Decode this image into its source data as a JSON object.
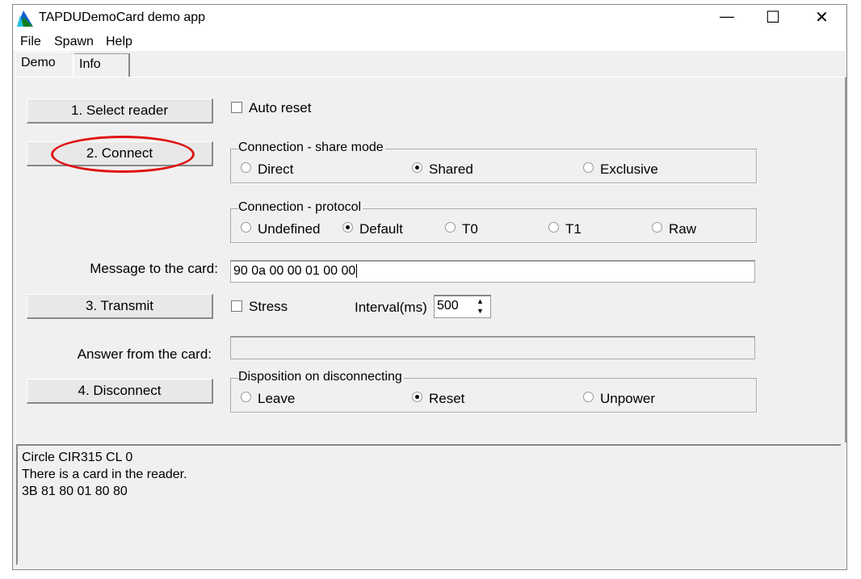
{
  "window": {
    "title": "TAPDUDemoCard demo app",
    "minimize": "—",
    "maximize": "☐",
    "close": "✕"
  },
  "menu": [
    "File",
    "Spawn",
    "Help"
  ],
  "tabs": [
    "Demo",
    "Info"
  ],
  "buttons": {
    "select_reader": "1. Select reader",
    "connect": "2. Connect",
    "transmit": "3. Transmit",
    "disconnect": "4. Disconnect"
  },
  "auto_reset": "Auto reset",
  "share_mode": {
    "legend": "Connection - share mode",
    "options": [
      "Direct",
      "Shared",
      "Exclusive"
    ],
    "selected": "Shared"
  },
  "protocol": {
    "legend": "Connection - protocol",
    "options": [
      "Undefined",
      "Default",
      "T0",
      "T1",
      "Raw"
    ],
    "selected": "Default"
  },
  "message": {
    "label": "Message to the card:",
    "value": "90 0a 00 00 01 00 00"
  },
  "stress": "Stress",
  "interval": {
    "label": "Interval(ms)",
    "value": "500"
  },
  "answer": {
    "label": "Answer from the card:",
    "value": ""
  },
  "disposition": {
    "legend": "Disposition on disconnecting",
    "options": [
      "Leave",
      "Reset",
      "Unpower"
    ],
    "selected": "Reset"
  },
  "log": [
    "Circle CIR315 CL 0",
    "There is a card in the reader.",
    "3B 81 80 01 80 80"
  ],
  "annotation_color": "#e01010"
}
